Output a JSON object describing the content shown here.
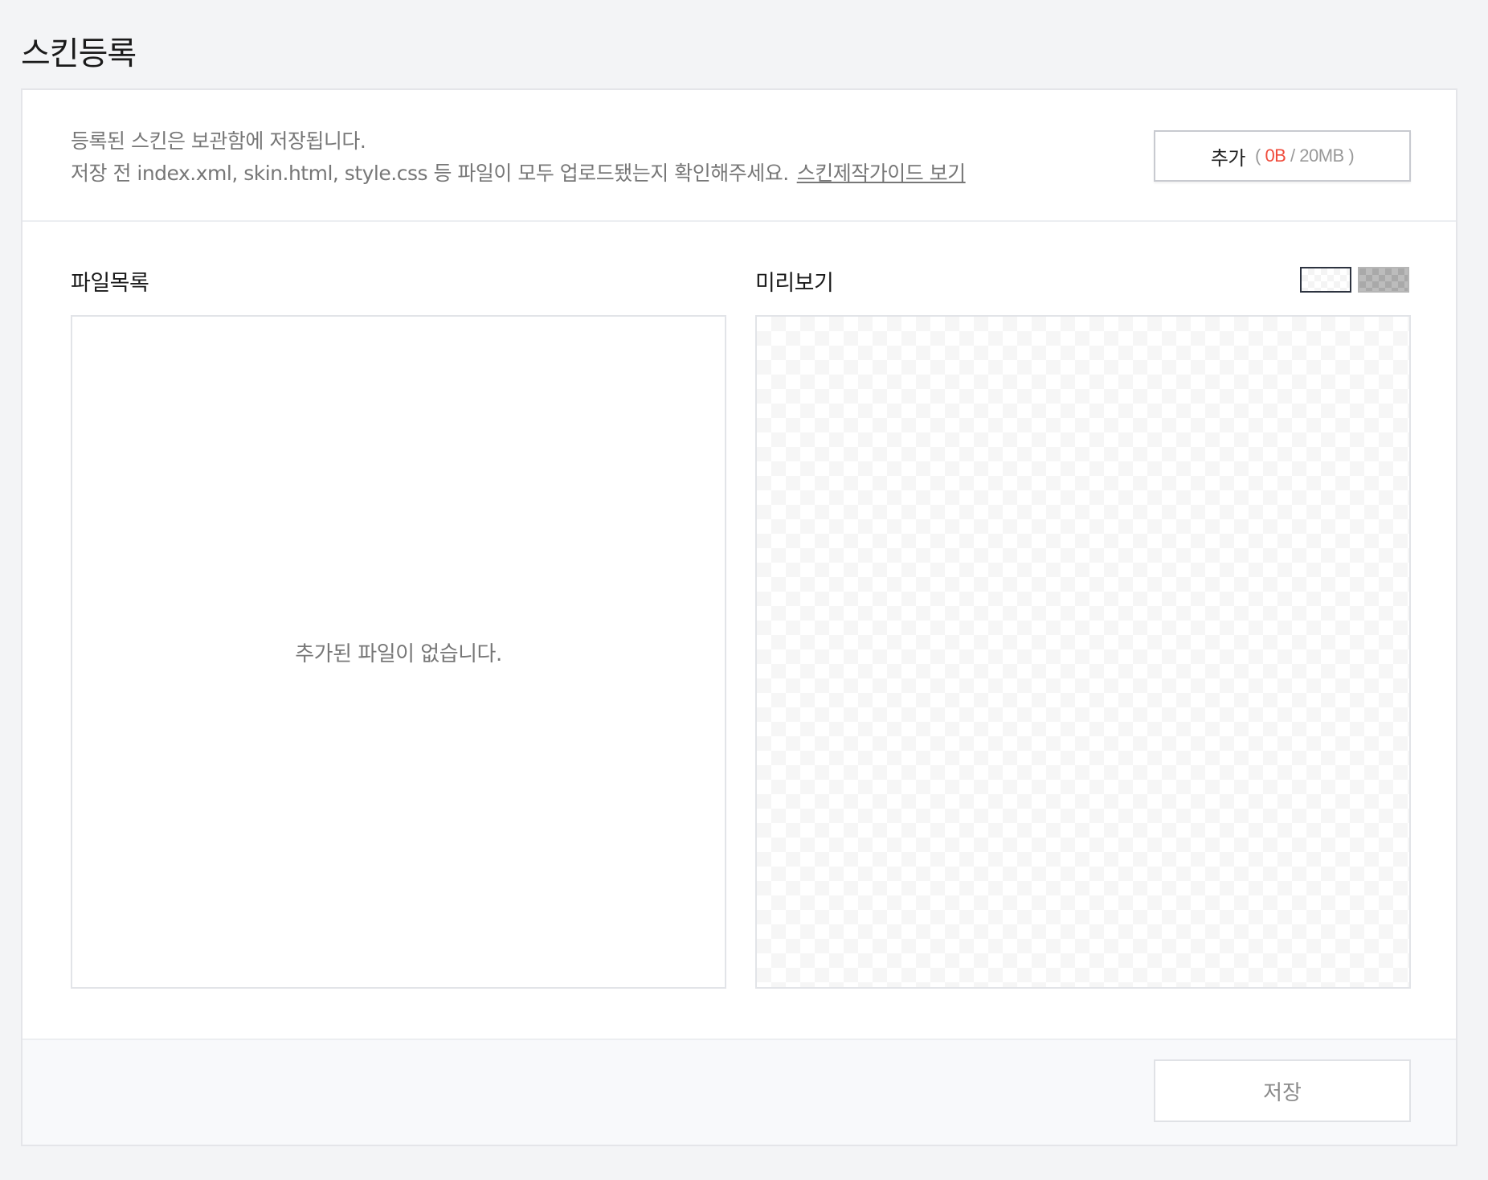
{
  "page": {
    "title": "스킨등록"
  },
  "notice": {
    "line1": "등록된 스킨은 보관함에 저장됩니다.",
    "line2": "저장 전 index.xml, skin.html, style.css 등 파일이 모두 업로드됐는지 확인해주세요.",
    "guide_link": "스킨제작가이드 보기"
  },
  "add_button": {
    "label": "추가",
    "open_paren": "(",
    "used": "0B",
    "separator": "/",
    "limit": "20MB",
    "close_paren": ")"
  },
  "file_list": {
    "title": "파일목록",
    "empty_message": "추가된 파일이 없습니다."
  },
  "preview": {
    "title": "미리보기",
    "toggles": [
      {
        "name": "light-checker",
        "selected": true
      },
      {
        "name": "dark-checker",
        "selected": false
      }
    ]
  },
  "footer": {
    "save_label": "저장"
  },
  "colors": {
    "accent_used": "#f04b3b",
    "page_bg": "#f3f4f6",
    "card_bg": "#ffffff"
  }
}
